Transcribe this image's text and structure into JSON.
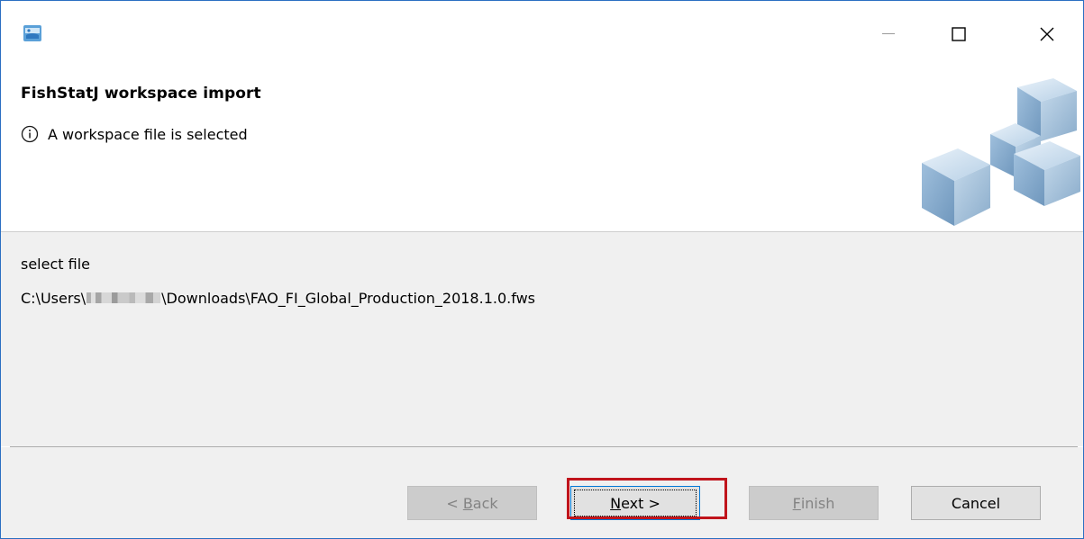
{
  "window": {
    "controls": {
      "minimize": "—",
      "maximize": "☐",
      "close": "✕"
    },
    "icon": "fishstatj-app-icon"
  },
  "header": {
    "title": "FishStatJ workspace import",
    "message": "A workspace file is selected",
    "message_icon": "info-icon",
    "banner_image": "cubes-graphic"
  },
  "content": {
    "label": "select file",
    "path_prefix": "C:\\Users\\",
    "path_suffix": "\\Downloads\\FAO_FI_Global_Production_2018.1.0.fws"
  },
  "buttons": {
    "back": {
      "before": "< ",
      "mnemonic": "B",
      "after": "ack",
      "enabled": false
    },
    "next": {
      "mnemonic": "N",
      "after": "ext >",
      "enabled": true,
      "highlighted": true
    },
    "finish": {
      "mnemonic": "F",
      "after": "inish",
      "enabled": false
    },
    "cancel": {
      "label": "Cancel",
      "enabled": true
    }
  },
  "colors": {
    "highlight_border": "#c0141c",
    "window_border": "#2b6fc2",
    "panel_bg": "#f0f0f0"
  }
}
